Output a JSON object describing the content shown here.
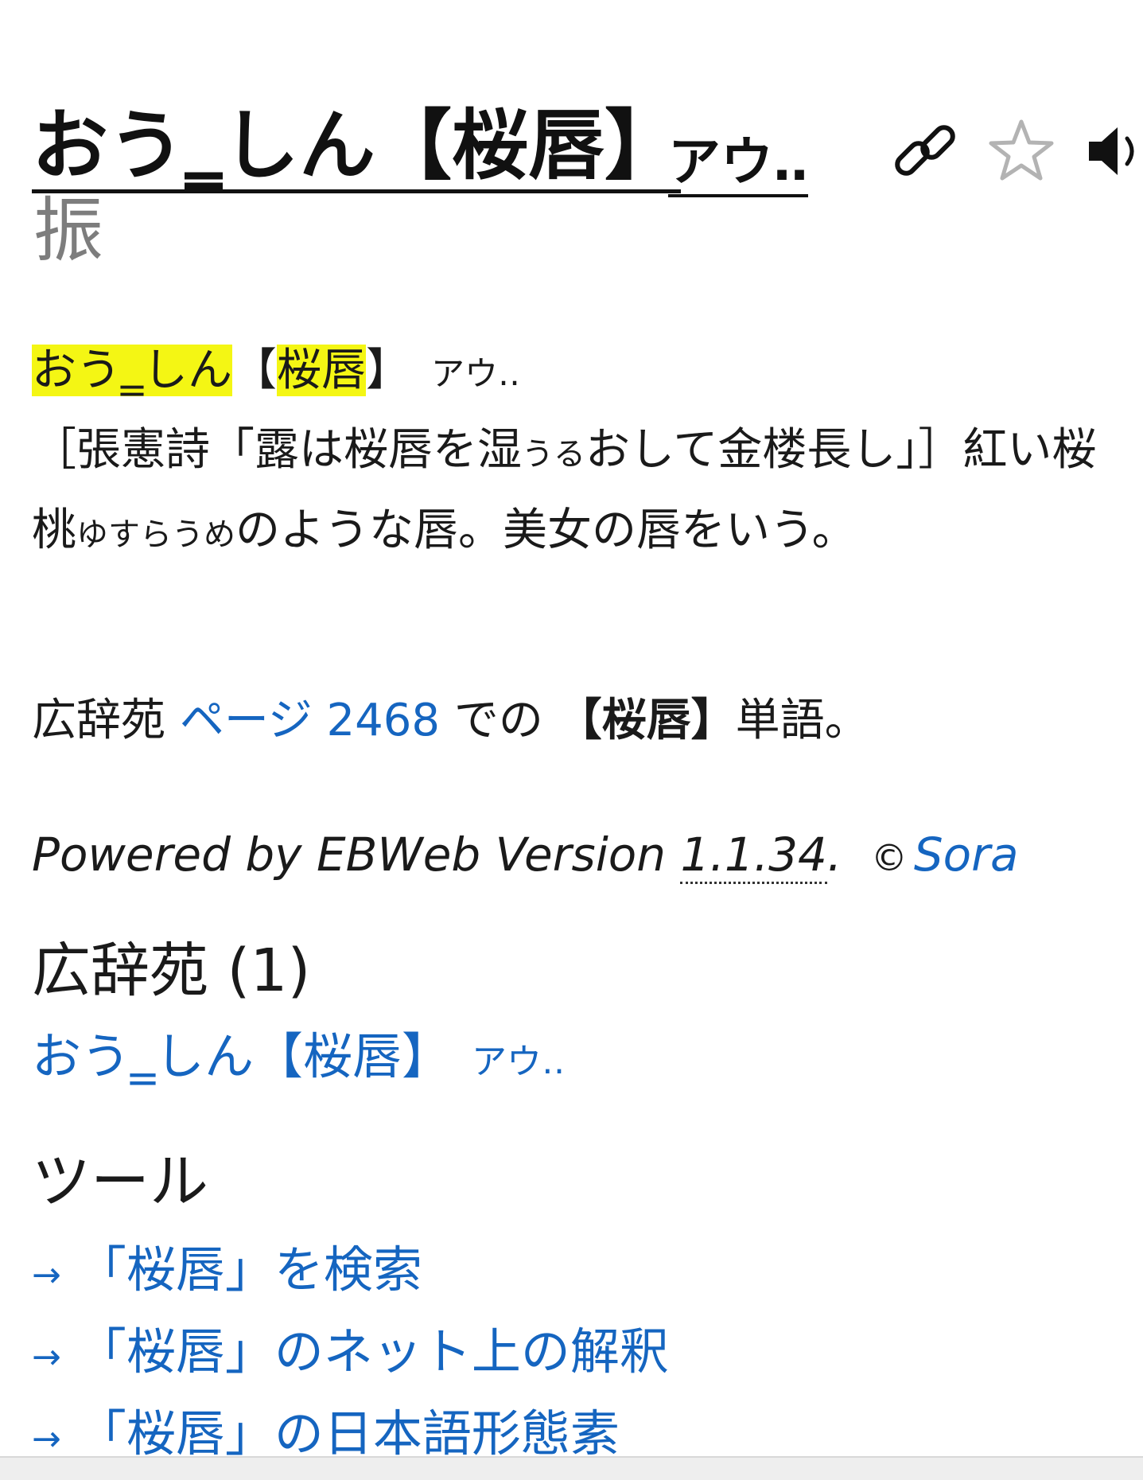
{
  "title": {
    "main": "おう‗しん【桜唇】",
    "sub": "アウ‥",
    "furigana_char": "振"
  },
  "icons": {
    "link": "link-icon",
    "star": "star-icon",
    "speaker": "speaker-icon"
  },
  "entry": {
    "head_kana": "おう‗しん",
    "head_bracket_open": "【",
    "head_kanji": "桜唇",
    "head_bracket_close": "】",
    "head_reading": "アウ‥",
    "body_part1": "［張憲詩「露は桜唇を湿",
    "ruby1": "うる",
    "body_part2": "おして金楼長し」］紅い桜桃",
    "ruby2": "ゆすらうめ",
    "body_part3": "のような唇。美女の唇をいう。"
  },
  "page_line": {
    "prefix": "広辞苑",
    "link_text": "ページ 2468",
    "middle": "での",
    "word": "【桜唇】",
    "suffix": "単語。"
  },
  "powered": {
    "prefix": "Powered by EBWeb Version",
    "version": "1.1.34",
    "dot": ".",
    "copyright": "©",
    "author": "Sora"
  },
  "dictionary": {
    "heading": "広辞苑 (1)",
    "result_main": "おう‗しん【桜唇】",
    "result_reading": "アウ‥"
  },
  "tools": {
    "heading": "ツール",
    "arrow": "→",
    "items": [
      "「桜唇」を検索",
      "「桜唇」のネット上の解釈",
      "「桜唇」の日本語形態素"
    ]
  },
  "colors": {
    "link": "#1565c0",
    "highlight": "#f4f614",
    "muted": "#7d7d7d"
  }
}
